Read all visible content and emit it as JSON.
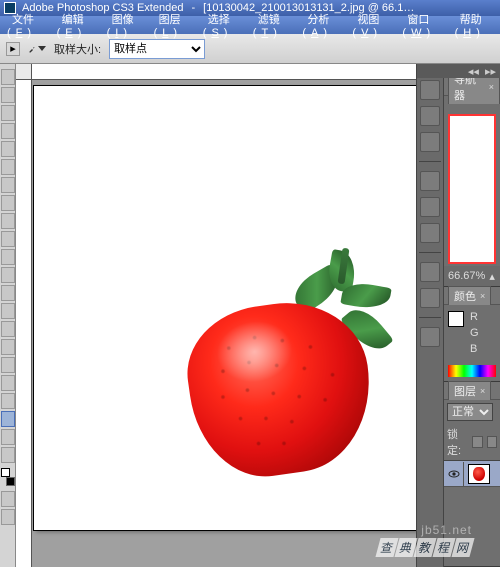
{
  "title": {
    "app": "Adobe Photoshop CS3 Extended",
    "doc": "[10130042_210013013131_2.jpg @ 66.1…"
  },
  "menu": {
    "items": [
      {
        "label": "文件",
        "key": "F"
      },
      {
        "label": "编辑",
        "key": "E"
      },
      {
        "label": "图像",
        "key": "I"
      },
      {
        "label": "图层",
        "key": "L"
      },
      {
        "label": "选择",
        "key": "S"
      },
      {
        "label": "滤镜",
        "key": "T"
      },
      {
        "label": "分析",
        "key": "A"
      },
      {
        "label": "视图",
        "key": "V"
      },
      {
        "label": "窗口",
        "key": "W"
      },
      {
        "label": "帮助",
        "key": "H"
      }
    ]
  },
  "options": {
    "sample_label": "取样大小:",
    "sample_value": "取样点"
  },
  "navigator": {
    "tab": "导航器",
    "zoom": "66.67%"
  },
  "colors": {
    "tab": "颜色",
    "channels": {
      "R": "R",
      "G": "G",
      "B": "B"
    }
  },
  "layers": {
    "tab": "图层",
    "blend": "正常",
    "lock_label": "锁定:"
  },
  "watermark": {
    "domain": "jb51.net",
    "text": "查典教程网"
  }
}
